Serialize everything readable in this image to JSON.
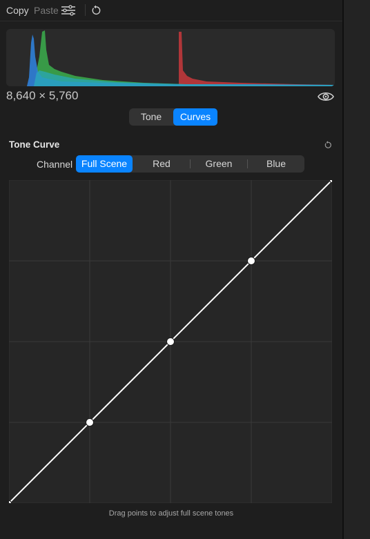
{
  "toolbar": {
    "copy_label": "Copy",
    "paste_label": "Paste",
    "adjust_icon": "sliders-icon",
    "reset_icon": "reset-arrow-icon"
  },
  "histogram": {
    "dimensions": "8,640 × 5,760",
    "visibility_icon": "eye-icon",
    "colors": {
      "red": "#d8383b",
      "green": "#3aa64a",
      "blue": "#2f7fd8",
      "cyan": "#2aa7b8"
    }
  },
  "mode_tabs": {
    "items": [
      "Tone",
      "Curves"
    ],
    "selected": "Curves"
  },
  "tone_curve": {
    "title": "Tone Curve",
    "reset_icon": "reset-arrow-icon",
    "channel_label": "Channel",
    "channels": [
      "Full Scene",
      "Red",
      "Green",
      "Blue"
    ],
    "selected_channel": "Full Scene",
    "points": [
      [
        0,
        0
      ],
      [
        0.25,
        0.25
      ],
      [
        0.5,
        0.5
      ],
      [
        0.75,
        0.75
      ],
      [
        1,
        1
      ]
    ],
    "hint": "Drag points to adjust full scene tones"
  },
  "colors": {
    "accent": "#0a84ff",
    "panel_bg": "#1e1e1e",
    "graph_bg": "#262626",
    "grid": "#3a3a3a"
  }
}
